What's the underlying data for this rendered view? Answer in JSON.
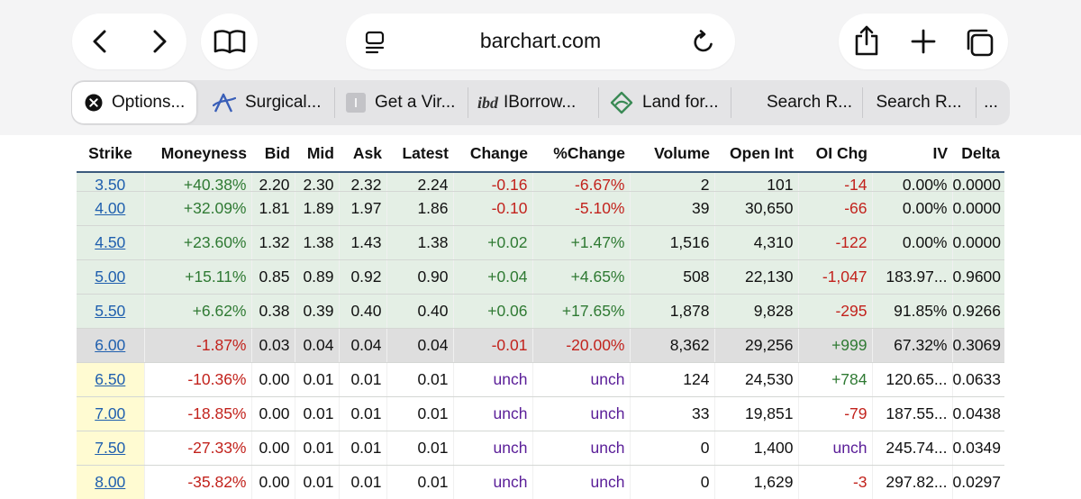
{
  "browser": {
    "url": "barchart.com",
    "tabs": [
      {
        "label": "Options...",
        "icon": "close-icon",
        "active": true
      },
      {
        "label": "Surgical...",
        "icon": "surgical-logo-icon"
      },
      {
        "label": "Get a Vir...",
        "icon": "gray-tile-icon"
      },
      {
        "label": "IBorrow...",
        "icon": "ibd-logo-icon",
        "icon_text": "ibd"
      },
      {
        "label": "Land for...",
        "icon": "land-logo-icon"
      },
      {
        "label": "Search R...",
        "icon": ""
      },
      {
        "label": "Search R...",
        "icon": ""
      },
      {
        "label": "...",
        "icon": ""
      }
    ]
  },
  "colors": {
    "positive": "#2f7a33",
    "negative": "#c2221c",
    "unchanged": "#5a1e98",
    "link": "#1f5fae",
    "in_the_money": "#e4efe5",
    "at_the_money": "#dedede",
    "header_rule": "#3b5a7c"
  },
  "table": {
    "headers": [
      "Strike",
      "Moneyness",
      "Bid",
      "Mid",
      "Ask",
      "Latest",
      "Change",
      "%Change",
      "Volume",
      "Open Int",
      "OI Chg",
      "IV",
      "Delta"
    ],
    "rows": [
      {
        "state": "itm",
        "partial": true,
        "cells": [
          "3.50",
          "+40.38%",
          "2.20",
          "2.30",
          "2.32",
          "2.24",
          "-0.16",
          "-6.67%",
          "2",
          "101",
          "-14",
          "0.00%",
          "0.0000"
        ]
      },
      {
        "state": "itm",
        "cells": [
          "4.00",
          "+32.09%",
          "1.81",
          "1.89",
          "1.97",
          "1.86",
          "-0.10",
          "-5.10%",
          "39",
          "30,650",
          "-66",
          "0.00%",
          "0.0000"
        ]
      },
      {
        "state": "itm",
        "cells": [
          "4.50",
          "+23.60%",
          "1.32",
          "1.38",
          "1.43",
          "1.38",
          "+0.02",
          "+1.47%",
          "1,516",
          "4,310",
          "-122",
          "0.00%",
          "0.0000"
        ]
      },
      {
        "state": "itm",
        "cells": [
          "5.00",
          "+15.11%",
          "0.85",
          "0.89",
          "0.92",
          "0.90",
          "+0.04",
          "+4.65%",
          "508",
          "22,130",
          "-1,047",
          "183.97...",
          "0.9600"
        ]
      },
      {
        "state": "itm",
        "cells": [
          "5.50",
          "+6.62%",
          "0.38",
          "0.39",
          "0.40",
          "0.40",
          "+0.06",
          "+17.65%",
          "1,878",
          "9,828",
          "-295",
          "91.85%",
          "0.9266"
        ]
      },
      {
        "state": "atm",
        "cells": [
          "6.00",
          "-1.87%",
          "0.03",
          "0.04",
          "0.04",
          "0.04",
          "-0.01",
          "-20.00%",
          "8,362",
          "29,256",
          "+999",
          "67.32%",
          "0.3069"
        ]
      },
      {
        "state": "otm",
        "cells": [
          "6.50",
          "-10.36%",
          "0.00",
          "0.01",
          "0.01",
          "0.01",
          "unch",
          "unch",
          "124",
          "24,530",
          "+784",
          "120.65...",
          "0.0633"
        ]
      },
      {
        "state": "otm",
        "cells": [
          "7.00",
          "-18.85%",
          "0.00",
          "0.01",
          "0.01",
          "0.01",
          "unch",
          "unch",
          "33",
          "19,851",
          "-79",
          "187.55...",
          "0.0438"
        ]
      },
      {
        "state": "otm",
        "cells": [
          "7.50",
          "-27.33%",
          "0.00",
          "0.01",
          "0.01",
          "0.01",
          "unch",
          "unch",
          "0",
          "1,400",
          "unch",
          "245.74...",
          "0.0349"
        ]
      },
      {
        "state": "otm",
        "cells": [
          "8.00",
          "-35.82%",
          "0.00",
          "0.01",
          "0.01",
          "0.01",
          "unch",
          "unch",
          "0",
          "1,629",
          "-3",
          "297.82...",
          "0.0297"
        ]
      }
    ]
  }
}
